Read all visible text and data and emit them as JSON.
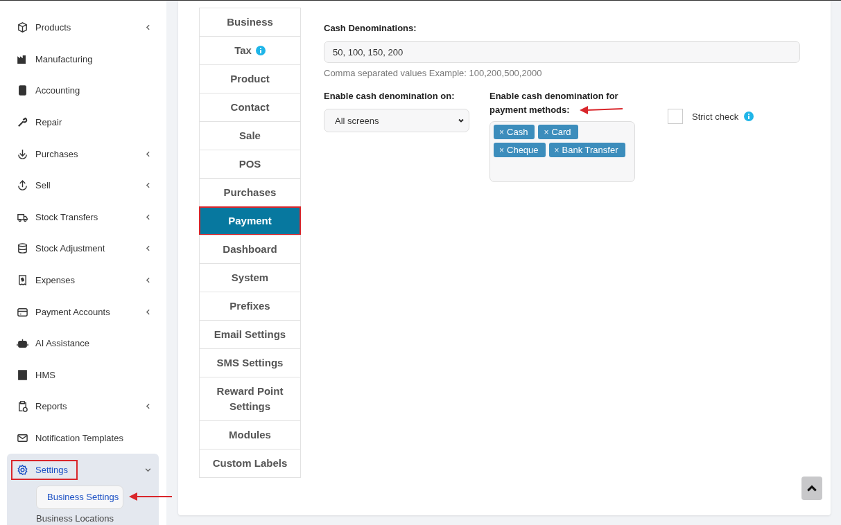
{
  "sidebar": {
    "items": [
      {
        "label": "Products",
        "has_submenu": true,
        "expanded": false,
        "highlighted": false
      },
      {
        "label": "Manufacturing",
        "has_submenu": false,
        "expanded": false,
        "highlighted": false
      },
      {
        "label": "Accounting",
        "has_submenu": false,
        "expanded": false,
        "highlighted": false
      },
      {
        "label": "Repair",
        "has_submenu": false,
        "expanded": false,
        "highlighted": false
      },
      {
        "label": "Purchases",
        "has_submenu": true,
        "expanded": false,
        "highlighted": false
      },
      {
        "label": "Sell",
        "has_submenu": true,
        "expanded": false,
        "highlighted": false
      },
      {
        "label": "Stock Transfers",
        "has_submenu": true,
        "expanded": false,
        "highlighted": false
      },
      {
        "label": "Stock Adjustment",
        "has_submenu": true,
        "expanded": false,
        "highlighted": false
      },
      {
        "label": "Expenses",
        "has_submenu": true,
        "expanded": false,
        "highlighted": false
      },
      {
        "label": "Payment Accounts",
        "has_submenu": true,
        "expanded": false,
        "highlighted": false
      },
      {
        "label": "AI Assistance",
        "has_submenu": false,
        "expanded": false,
        "highlighted": false
      },
      {
        "label": "HMS",
        "has_submenu": false,
        "expanded": false,
        "highlighted": false
      },
      {
        "label": "Reports",
        "has_submenu": true,
        "expanded": false,
        "highlighted": false
      },
      {
        "label": "Notification Templates",
        "has_submenu": false,
        "expanded": false,
        "highlighted": false
      },
      {
        "label": "Settings",
        "has_submenu": true,
        "expanded": true,
        "highlighted": true,
        "children": [
          {
            "label": "Business Settings",
            "selected": true,
            "arrow": true
          },
          {
            "label": "Business Locations",
            "selected": false,
            "arrow": false
          }
        ]
      }
    ]
  },
  "settings_tabs": [
    {
      "label": "Business",
      "selected": false,
      "highlighted": false,
      "info": false
    },
    {
      "label": "Tax",
      "selected": false,
      "highlighted": false,
      "info": true
    },
    {
      "label": "Product",
      "selected": false,
      "highlighted": false,
      "info": false
    },
    {
      "label": "Contact",
      "selected": false,
      "highlighted": false,
      "info": false
    },
    {
      "label": "Sale",
      "selected": false,
      "highlighted": false,
      "info": false
    },
    {
      "label": "POS",
      "selected": false,
      "highlighted": false,
      "info": false
    },
    {
      "label": "Purchases",
      "selected": false,
      "highlighted": false,
      "info": false
    },
    {
      "label": "Payment",
      "selected": true,
      "highlighted": true,
      "info": false
    },
    {
      "label": "Dashboard",
      "selected": false,
      "highlighted": false,
      "info": false
    },
    {
      "label": "System",
      "selected": false,
      "highlighted": false,
      "info": false
    },
    {
      "label": "Prefixes",
      "selected": false,
      "highlighted": false,
      "info": false
    },
    {
      "label": "Email Settings",
      "selected": false,
      "highlighted": false,
      "info": false
    },
    {
      "label": "SMS Settings",
      "selected": false,
      "highlighted": false,
      "info": false
    },
    {
      "label": "Reward Point Settings",
      "selected": false,
      "highlighted": false,
      "info": false
    },
    {
      "label": "Modules",
      "selected": false,
      "highlighted": false,
      "info": false
    },
    {
      "label": "Custom Labels",
      "selected": false,
      "highlighted": false,
      "info": false
    }
  ],
  "payment": {
    "cash_denominations": {
      "label": "Cash Denominations:",
      "value": "50, 100, 150, 200",
      "help": "Comma separated values Example: 100,200,500,2000"
    },
    "enable_on": {
      "label": "Enable cash denomination on:",
      "value": "All screens"
    },
    "payment_methods": {
      "label": "Enable cash denomination for payment methods:",
      "arrow": true,
      "tags": [
        {
          "remove": "×",
          "label": "Cash"
        },
        {
          "remove": "×",
          "label": "Card"
        },
        {
          "remove": "×",
          "label": "Cheque"
        },
        {
          "remove": "×",
          "label": "Bank Transfer"
        }
      ]
    },
    "strict_check": {
      "label": "Strict check",
      "checked": false
    }
  }
}
